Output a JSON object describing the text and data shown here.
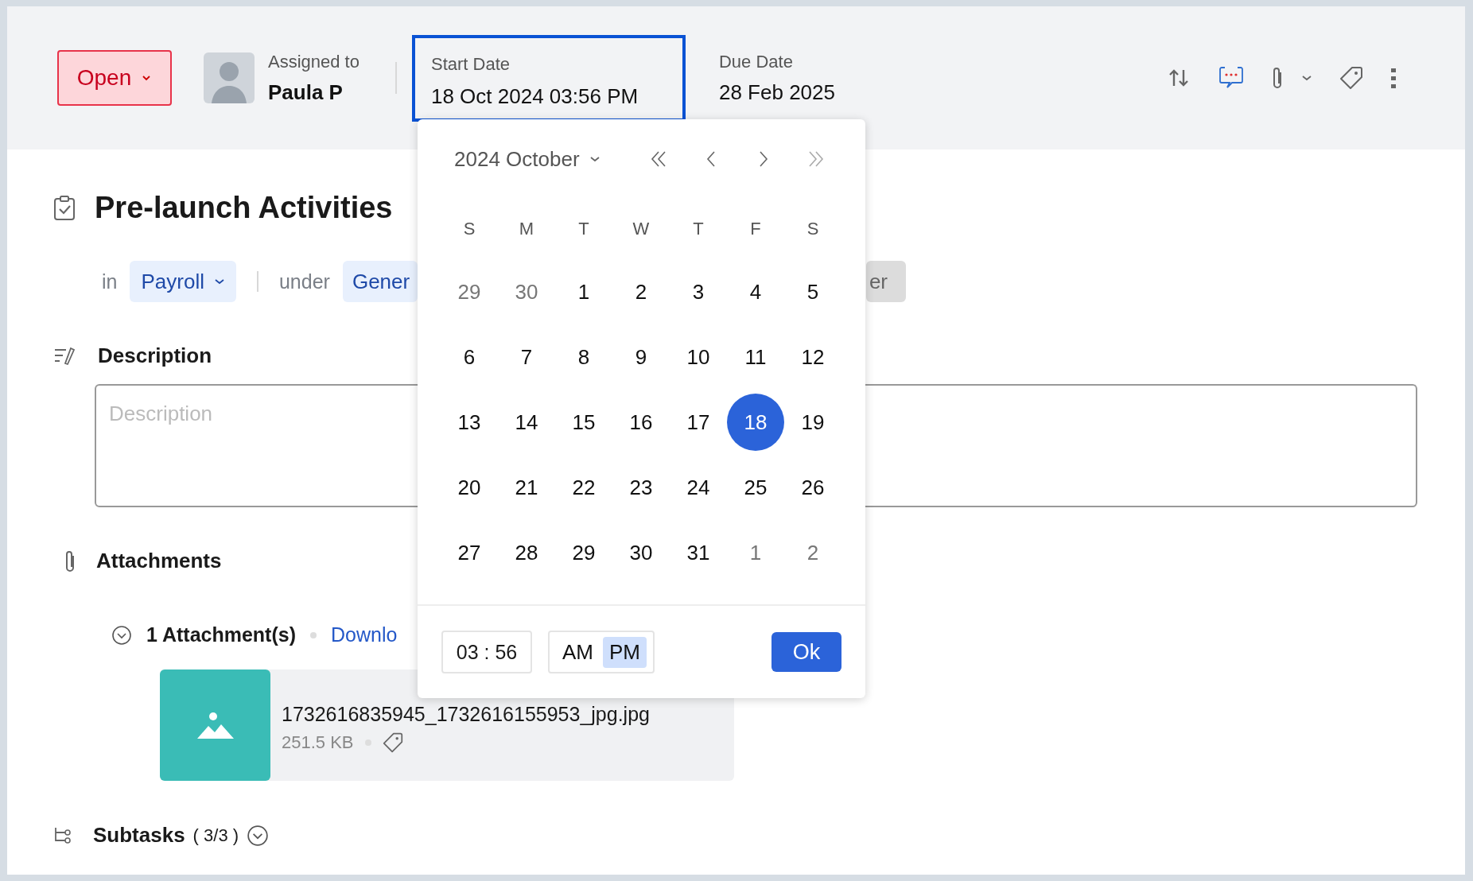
{
  "header": {
    "status": {
      "label": "Open"
    },
    "assignee": {
      "label": "Assigned to",
      "name": "Paula P"
    },
    "start_date": {
      "label": "Start Date",
      "value": "18 Oct 2024 03:56 PM",
      "selected": true
    },
    "due_date": {
      "label": "Due Date",
      "value": "28 Feb 2025"
    }
  },
  "task": {
    "title": "Pre-launch Activities",
    "in_label": "in",
    "project": "Payroll",
    "under_label": "under",
    "list": "Gener",
    "chip_2": "er"
  },
  "description": {
    "label": "Description",
    "placeholder": "Description"
  },
  "attachments": {
    "label": "Attachments",
    "count": "1 Attachment(s)",
    "download": "Downlo",
    "files": [
      {
        "name": "1732616835945_1732616155953_jpg.jpg",
        "size": "251.5 KB"
      }
    ]
  },
  "subtasks": {
    "label": "Subtasks",
    "count": "( 3/3 )"
  },
  "date_picker": {
    "month_label": "2024 October",
    "weekdays": [
      "S",
      "M",
      "T",
      "W",
      "T",
      "F",
      "S"
    ],
    "days": [
      {
        "day": "29",
        "outside": true,
        "selected": false
      },
      {
        "day": "30",
        "outside": true,
        "selected": false
      },
      {
        "day": "1",
        "outside": false,
        "selected": false
      },
      {
        "day": "2",
        "outside": false,
        "selected": false
      },
      {
        "day": "3",
        "outside": false,
        "selected": false
      },
      {
        "day": "4",
        "outside": false,
        "selected": false
      },
      {
        "day": "5",
        "outside": false,
        "selected": false
      },
      {
        "day": "6",
        "outside": false,
        "selected": false
      },
      {
        "day": "7",
        "outside": false,
        "selected": false
      },
      {
        "day": "8",
        "outside": false,
        "selected": false
      },
      {
        "day": "9",
        "outside": false,
        "selected": false
      },
      {
        "day": "10",
        "outside": false,
        "selected": false
      },
      {
        "day": "11",
        "outside": false,
        "selected": false
      },
      {
        "day": "12",
        "outside": false,
        "selected": false
      },
      {
        "day": "13",
        "outside": false,
        "selected": false
      },
      {
        "day": "14",
        "outside": false,
        "selected": false
      },
      {
        "day": "15",
        "outside": false,
        "selected": false
      },
      {
        "day": "16",
        "outside": false,
        "selected": false
      },
      {
        "day": "17",
        "outside": false,
        "selected": false
      },
      {
        "day": "18",
        "outside": false,
        "selected": true
      },
      {
        "day": "19",
        "outside": false,
        "selected": false
      },
      {
        "day": "20",
        "outside": false,
        "selected": false
      },
      {
        "day": "21",
        "outside": false,
        "selected": false
      },
      {
        "day": "22",
        "outside": false,
        "selected": false
      },
      {
        "day": "23",
        "outside": false,
        "selected": false
      },
      {
        "day": "24",
        "outside": false,
        "selected": false
      },
      {
        "day": "25",
        "outside": false,
        "selected": false
      },
      {
        "day": "26",
        "outside": false,
        "selected": false
      },
      {
        "day": "27",
        "outside": false,
        "selected": false
      },
      {
        "day": "28",
        "outside": false,
        "selected": false
      },
      {
        "day": "29",
        "outside": false,
        "selected": false
      },
      {
        "day": "30",
        "outside": false,
        "selected": false
      },
      {
        "day": "31",
        "outside": false,
        "selected": false
      },
      {
        "day": "1",
        "outside": true,
        "selected": false
      },
      {
        "day": "2",
        "outside": true,
        "selected": false
      }
    ],
    "time": "03 : 56",
    "meridiem": [
      {
        "label": "AM",
        "selected": false
      },
      {
        "label": "PM",
        "selected": true
      }
    ],
    "ok": "Ok"
  }
}
